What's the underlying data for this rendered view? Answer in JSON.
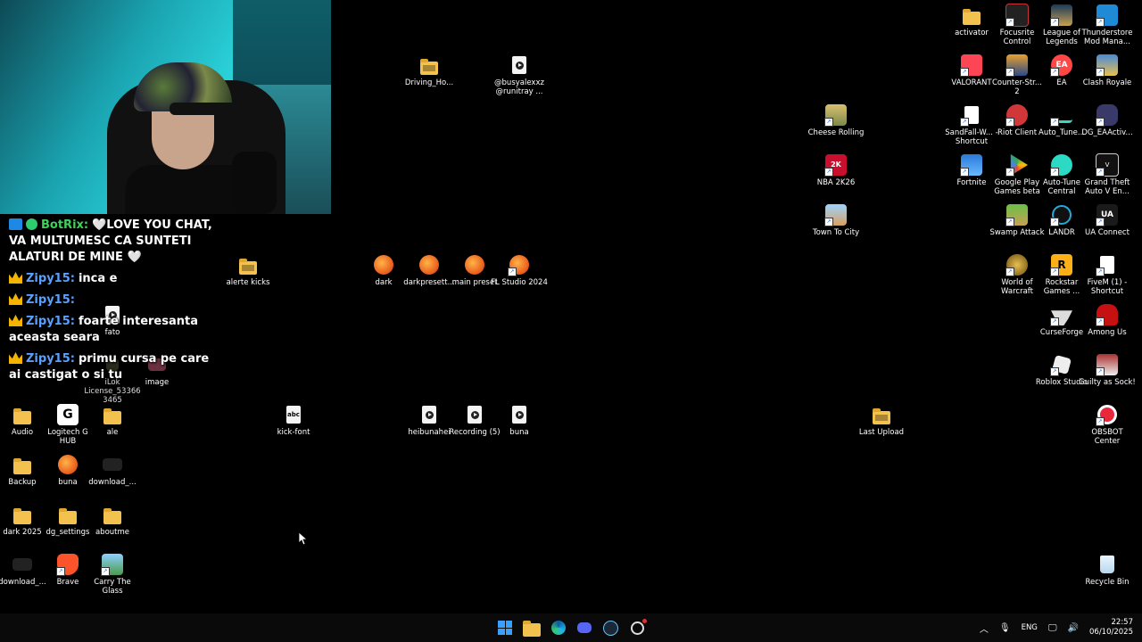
{
  "chat": [
    {
      "user": "BotRix:",
      "text": "🤍LOVE YOU CHAT, VA MULTUMESC CA SUNTETI ALATURI DE MINE 🤍",
      "kind": "bot"
    },
    {
      "user": "Zipy15:",
      "text": "inca e",
      "kind": "crown"
    },
    {
      "user": "Zipy15:",
      "text": "",
      "kind": "crown"
    },
    {
      "user": "Zipy15:",
      "text": "foarte interesanta aceasta seara",
      "kind": "crown"
    },
    {
      "user": "Zipy15:",
      "text": "primu cursa pe care ai castigat o si tu",
      "kind": "crown"
    }
  ],
  "desktop_left": [
    {
      "label": "Audio"
    },
    {
      "label": "Logitech G HUB"
    },
    {
      "label": "ale"
    },
    {
      "label": "Backup"
    },
    {
      "label": "buna"
    },
    {
      "label": "download_..."
    },
    {
      "label": "dark 2025"
    },
    {
      "label": "dg_settings"
    },
    {
      "label": "aboutme"
    },
    {
      "label": "download_..."
    },
    {
      "label": "Brave"
    },
    {
      "label": "Carry The Glass"
    },
    {
      "label": "fato"
    },
    {
      "label": "image"
    },
    {
      "label": "iLok License_533663465"
    }
  ],
  "desktop_middle": [
    {
      "label": "Driving_Ho..."
    },
    {
      "label": "@busyalexxz @runitray ..."
    },
    {
      "label": "alerte kicks"
    },
    {
      "label": "dark"
    },
    {
      "label": "darkpresett..."
    },
    {
      "label": "main preset"
    },
    {
      "label": "FL Studio 2024"
    },
    {
      "label": "kick-font"
    },
    {
      "label": "heibunahei"
    },
    {
      "label": "Recording (5)"
    },
    {
      "label": "buna"
    },
    {
      "label": "Cheese Rolling"
    },
    {
      "label": "NBA 2K26"
    },
    {
      "label": "Town To City"
    },
    {
      "label": "Last Upload"
    }
  ],
  "desktop_right": [
    {
      "label": "activator"
    },
    {
      "label": "Focusrite Control"
    },
    {
      "label": "League of Legends"
    },
    {
      "label": "Thunderstore Mod Mana..."
    },
    {
      "label": "VALORANT"
    },
    {
      "label": "Counter-Str... 2"
    },
    {
      "label": "EA"
    },
    {
      "label": "Clash Royale"
    },
    {
      "label": "SandFall-W... - Shortcut"
    },
    {
      "label": "Riot Client"
    },
    {
      "label": "Auto_Tune..."
    },
    {
      "label": "DG_EAActiv..."
    },
    {
      "label": "Fortnite"
    },
    {
      "label": "Google Play Games beta"
    },
    {
      "label": "Auto-Tune Central"
    },
    {
      "label": "Grand Theft Auto V En..."
    },
    {
      "label": "Swamp Attack"
    },
    {
      "label": "LANDR"
    },
    {
      "label": "UA Connect"
    },
    {
      "label": "World of Warcraft"
    },
    {
      "label": "Rockstar Games ..."
    },
    {
      "label": "FiveM (1) - Shortcut"
    },
    {
      "label": "CurseForge"
    },
    {
      "label": "Among Us"
    },
    {
      "label": "Roblox Studio"
    },
    {
      "label": "Guilty as Sock!"
    },
    {
      "label": "OBSBOT Center"
    },
    {
      "label": "Recycle Bin"
    }
  ],
  "tray": {
    "lang": "ENG",
    "time": "22:57",
    "date": "06/10/2025"
  },
  "colors": {
    "accent": "#3aa0ff",
    "folder": "#f2c14e",
    "chat_name": "#5aa0ff",
    "bot_name": "#3fd15a"
  }
}
